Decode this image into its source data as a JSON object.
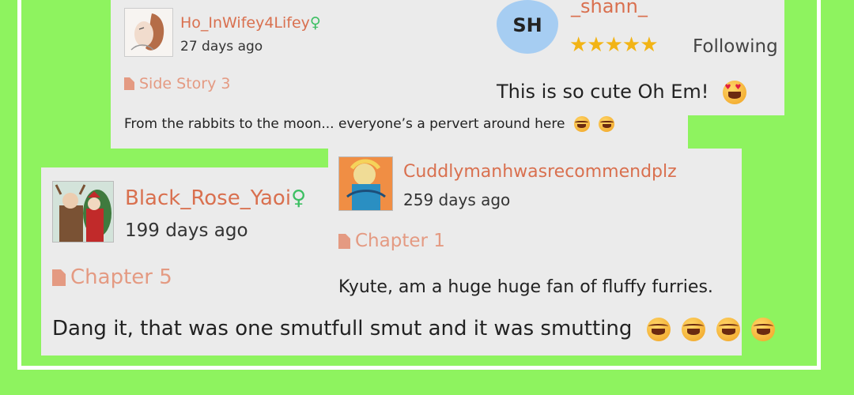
{
  "comments": [
    {
      "username": "Ho_InWifey4Lifey",
      "gender_symbol": "♀",
      "time": "27 days ago",
      "chapter": "Side Story 3",
      "text": "From the rabbits to the moon... everyone’s a pervert around here"
    },
    {
      "avatar_initials": "SH",
      "username": "_shann_",
      "rating_stars": 5,
      "rating_display": "★★★★★",
      "status": "Following",
      "text": "This is so cute Oh Em!"
    },
    {
      "username": "Black_Rose_Yaoi",
      "gender_symbol": "♀",
      "time": "199 days ago",
      "chapter": "Chapter 5",
      "text": "Dang it, that was one smutfull smut and it was smutting"
    },
    {
      "username": "Cuddlymanhwasrecommendplz",
      "time": "259 days ago",
      "chapter": "Chapter 1",
      "text": "Kyute, am a huge huge fan of fluffy furries."
    }
  ],
  "colors": {
    "background": "#8ef35f",
    "card": "#ebebeb",
    "username": "#d9704f",
    "chapter": "#e49a82",
    "female_symbol": "#3cbf62",
    "avatar_initials_bg": "#a6cdf2",
    "star": "#f2b416"
  }
}
